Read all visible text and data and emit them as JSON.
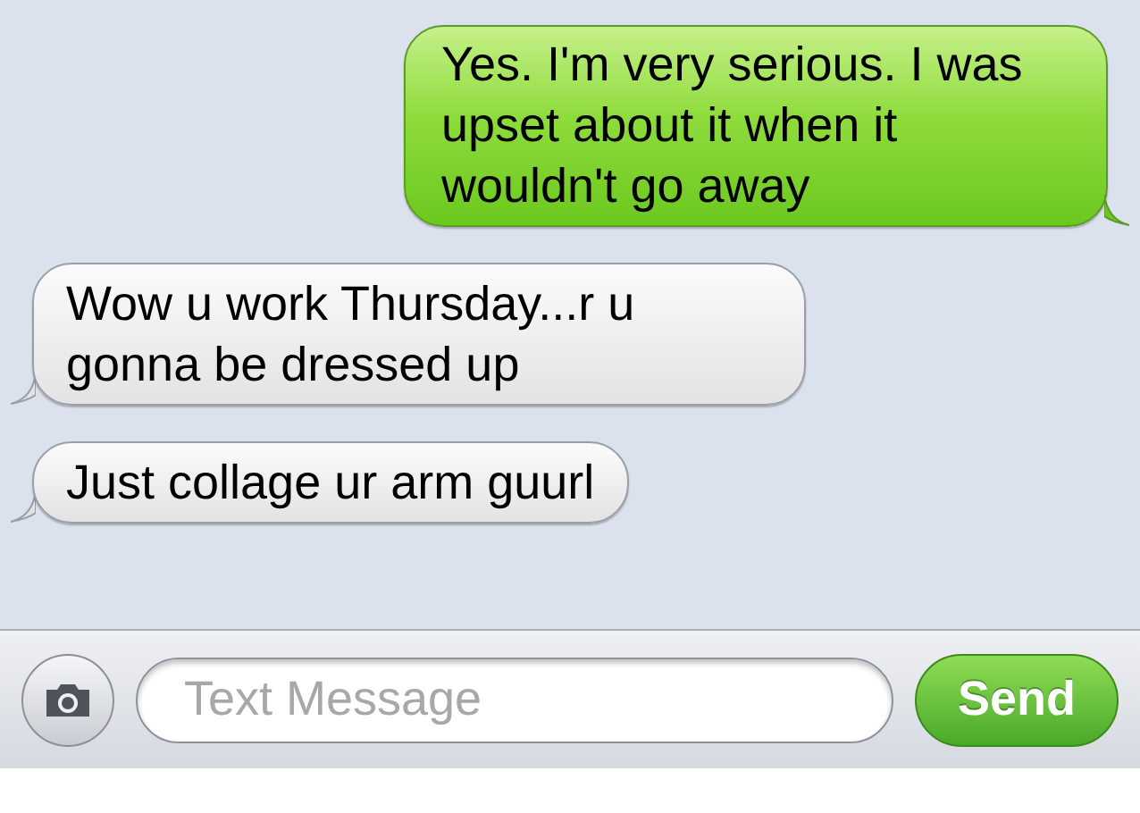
{
  "messages": [
    {
      "kind": "sent",
      "text": "Yes. I'm very serious. I was upset about it when it wouldn't go away"
    },
    {
      "kind": "received",
      "text": "Wow u work Thursday...r u gonna be dressed up"
    },
    {
      "kind": "received",
      "text": "Just collage ur arm guurl"
    }
  ],
  "composer": {
    "placeholder": "Text Message",
    "send_label": "Send"
  }
}
